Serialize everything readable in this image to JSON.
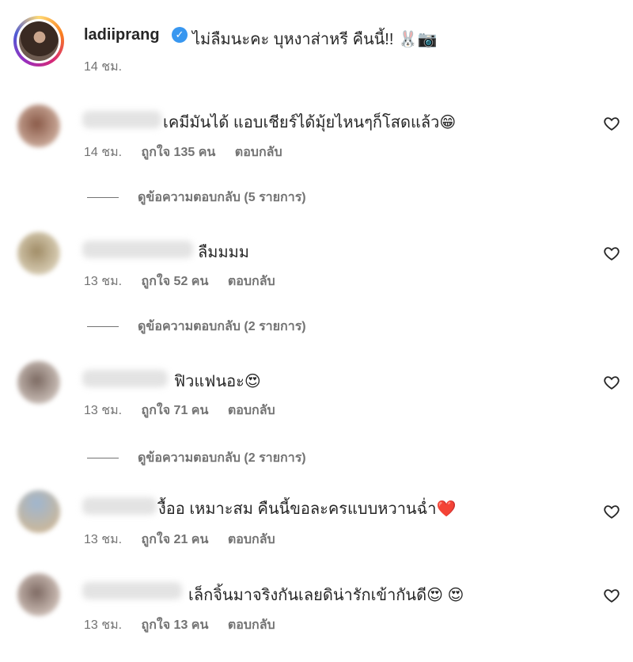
{
  "caption": {
    "username": "ladiiprang",
    "verified_icon": "verified-badge-icon",
    "text": "ไม่ลืมนะคะ บุหงาส่าหรี คืนนี้!! 🐰📷",
    "time": "14 ชม."
  },
  "comments": [
    {
      "text": "เคมีมันได้ แอบเชียร์ได้มุ้ยไหนๆก็โสดแล้ว😁",
      "time": "14 ชม.",
      "likes": "ถูกใจ 135 คน",
      "reply": "ตอบกลับ",
      "view_replies": "ดูข้อความตอบกลับ (5 รายการ)"
    },
    {
      "text": "ลืมมมม",
      "time": "13 ชม.",
      "likes": "ถูกใจ 52 คน",
      "reply": "ตอบกลับ",
      "view_replies": "ดูข้อความตอบกลับ (2 รายการ)"
    },
    {
      "text": "ฟิวแฟนอะ😍",
      "time": "13 ชม.",
      "likes": "ถูกใจ 71 คน",
      "reply": "ตอบกลับ",
      "view_replies": "ดูข้อความตอบกลับ (2 รายการ)"
    },
    {
      "text": "งื้ออ เหมาะสม คืนนี้ขอละครแบบหวานฉ่ำ❤️",
      "time": "13 ชม.",
      "likes": "ถูกใจ 21 คน",
      "reply": "ตอบกลับ"
    },
    {
      "text": "เล็กจิ้นมาจริงกันเลยดิน่ารักเข้ากันดี😍 😍",
      "time": "13 ชม.",
      "likes": "ถูกใจ 13 คน",
      "reply": "ตอบกลับ"
    }
  ]
}
